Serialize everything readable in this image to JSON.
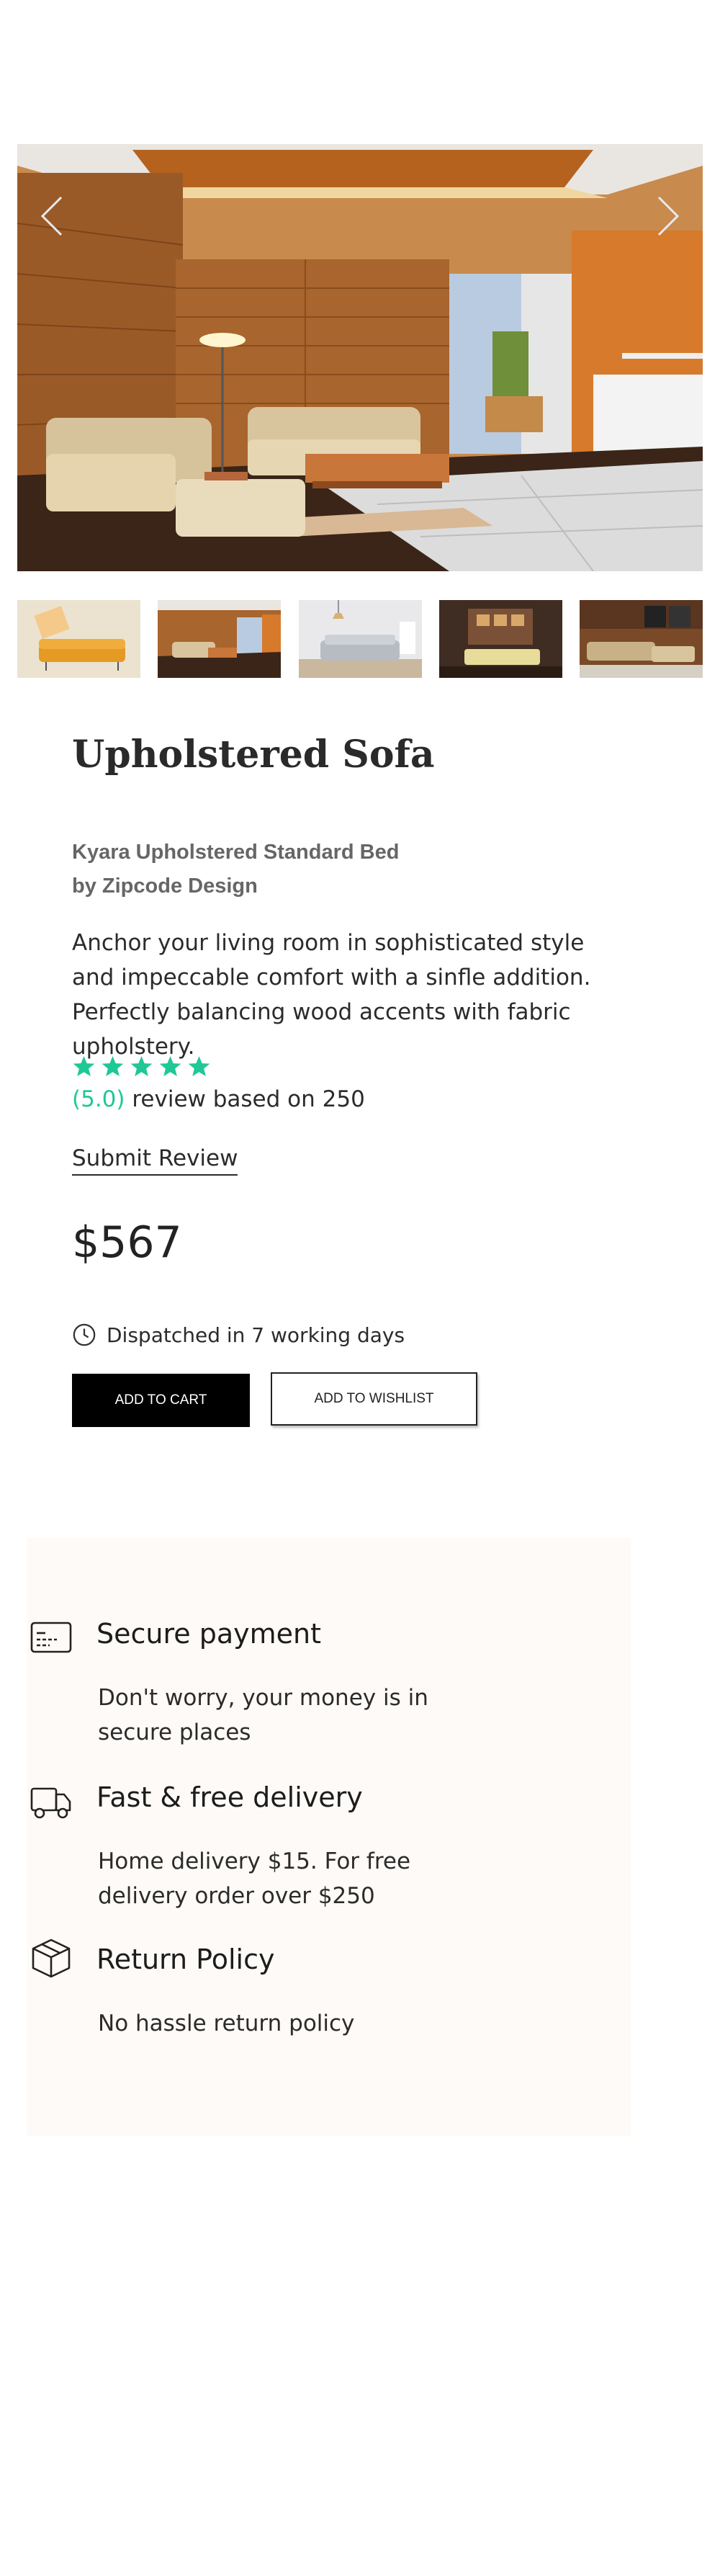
{
  "product": {
    "title": "Upholstered Sofa",
    "subtitle_line1": "Kyara Upholstered Standard Bed",
    "subtitle_line2": "by Zipcode Design",
    "description": "Anchor your living room in sophisticated style and impeccable comfort with a sinfle addition. Perfectly balancing wood accents with fabric upholstery.",
    "rating_value": 5.0,
    "rating_score": "(5.0)",
    "rating_text": " review based on 250",
    "submit_review": "Submit Review",
    "price": "$567",
    "dispatch": "Dispatched in 7 working days",
    "add_to_cart": "ADD TO CART",
    "add_to_wishlist": "ADD TO WISHLIST"
  },
  "gallery": {
    "prev_icon": "chevron-left-icon",
    "next_icon": "chevron-right-icon",
    "thumbnail_count": 5
  },
  "features": [
    {
      "icon": "credit-card-icon",
      "title": "Secure payment",
      "line1": "Don't worry, your money is in",
      "line2": "secure places"
    },
    {
      "icon": "truck-icon",
      "title": "Fast & free delivery",
      "line1": "Home delivery $15. For free",
      "line2": "delivery order over $250"
    },
    {
      "icon": "box-icon",
      "title": "Return Policy",
      "line1": "No hassle return policy",
      "line2": ""
    }
  ],
  "colors": {
    "accent": "#1fc896",
    "features_bg": "#fefaf7",
    "button_dark": "#000000"
  }
}
